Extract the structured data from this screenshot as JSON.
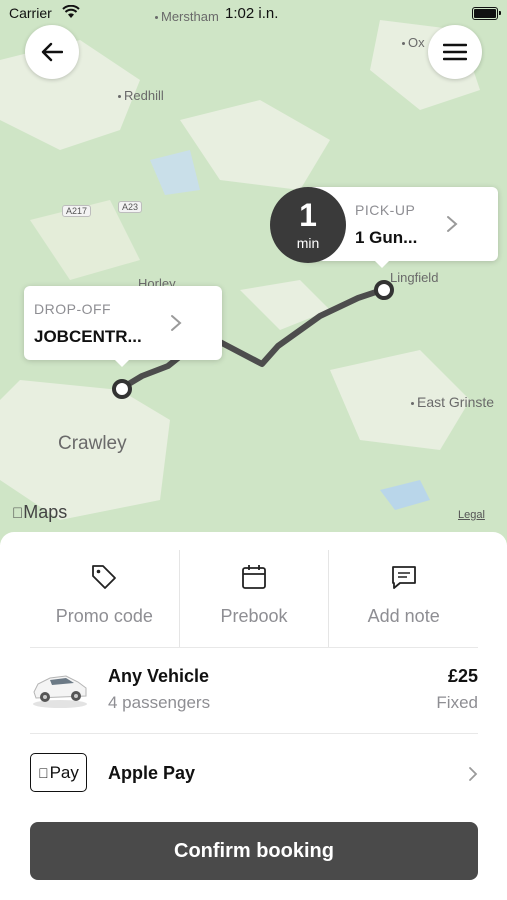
{
  "status": {
    "carrier": "Carrier",
    "time": "1:02 i.n."
  },
  "map": {
    "places": {
      "merstham": "Merstham",
      "oxted": "Ox",
      "redhill": "Redhill",
      "horley": "Horley",
      "lingfield": "Lingfield",
      "crawley": "Crawley",
      "east_grinstead": "East Grinste"
    },
    "roads": {
      "a217": "A217",
      "a23": "A23"
    },
    "attribution": {
      "maps": "Maps",
      "legal": "Legal"
    }
  },
  "eta": {
    "value": "1",
    "unit": "min"
  },
  "pickup": {
    "label": "PICK-UP",
    "value": "1 Gun..."
  },
  "dropoff": {
    "label": "DROP-OFF",
    "value": "JOBCENTR..."
  },
  "actions": {
    "promo": "Promo code",
    "prebook": "Prebook",
    "note": "Add note"
  },
  "vehicle": {
    "name": "Any Vehicle",
    "passengers": "4 passengers",
    "price": "£25",
    "price_type": "Fixed"
  },
  "payment": {
    "badge": "Pay",
    "method": "Apple Pay"
  },
  "confirm_label": "Confirm booking",
  "icons": [
    "back-arrow-icon",
    "menu-icon",
    "chevron-right-icon",
    "tag-icon",
    "calendar-icon",
    "message-icon",
    "car-icon",
    "apple-icon",
    "wifi-icon",
    "battery-icon"
  ]
}
